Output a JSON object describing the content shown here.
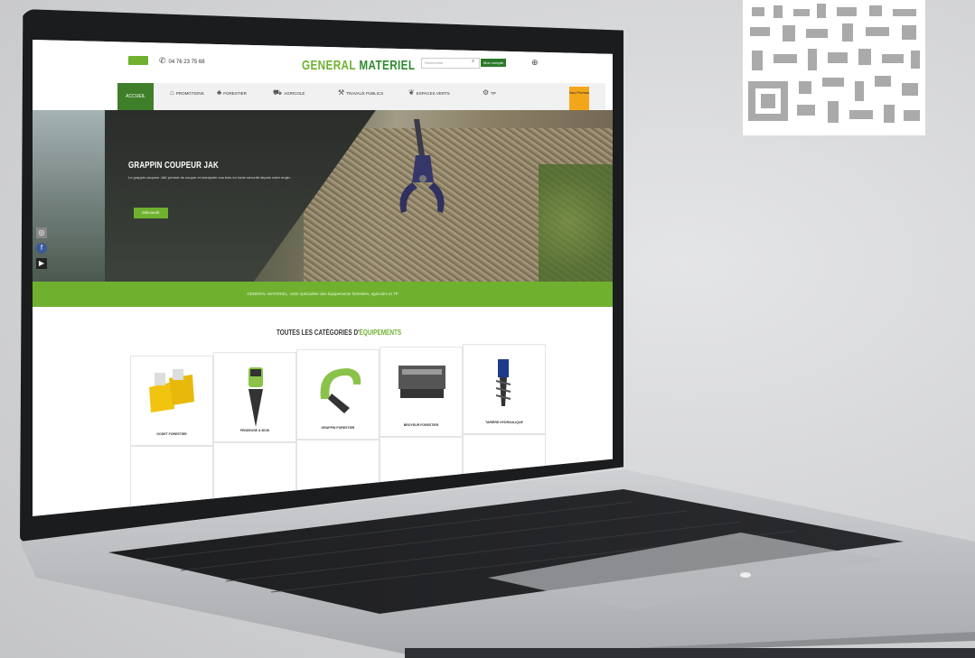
{
  "site": {
    "top_button": "",
    "phone": "04 76 23 75 68",
    "logo_part1": "GENERAL ",
    "logo_part2": "MATERIEL",
    "search_placeholder": "Rechercher",
    "account_label": "Mon compte"
  },
  "nav": {
    "home_label": "ACCUEIL",
    "items": [
      {
        "label": "PROMOTIONS",
        "icon": "tag-icon"
      },
      {
        "label": "FORESTIER",
        "icon": "tree-icon"
      },
      {
        "label": "AGRICOLE",
        "icon": "tractor-icon"
      },
      {
        "label": "TRAVAUX PUBLICS",
        "icon": "excavator-icon"
      },
      {
        "label": "ESPACES VERTS",
        "icon": "leaf-icon"
      },
      {
        "label": "TP",
        "icon": "loader-icon"
      }
    ],
    "promo_label": "Nos Promos"
  },
  "hero": {
    "title": "GRAPPIN COUPEUR JAK",
    "text": "Le grappin coupeur JAK permet de couper et manipuler vos bois en toute sécurité depuis votre engin.",
    "button_label": "Découvrir"
  },
  "band_text": "GENERAL MATERIEL, votre spécialiste des équipements forestiers, agricoles et TP",
  "categories": {
    "title_part1": "TOUTES LES CATÉGORIES D'",
    "title_part2": "ÉQUIPEMENTS",
    "subtitle": "",
    "items": [
      {
        "label": "GODET FORESTIER"
      },
      {
        "label": "FENDEUSE À BOIS"
      },
      {
        "label": "GRAPPIN FORESTIER"
      },
      {
        "label": "BROYEUR FORESTIER"
      },
      {
        "label": "TARIÈRE HYDRAULIQUE"
      }
    ]
  },
  "colors": {
    "brand_green": "#6fb12f",
    "dark_green": "#3f7f2a",
    "promo_orange": "#f4a61b"
  }
}
